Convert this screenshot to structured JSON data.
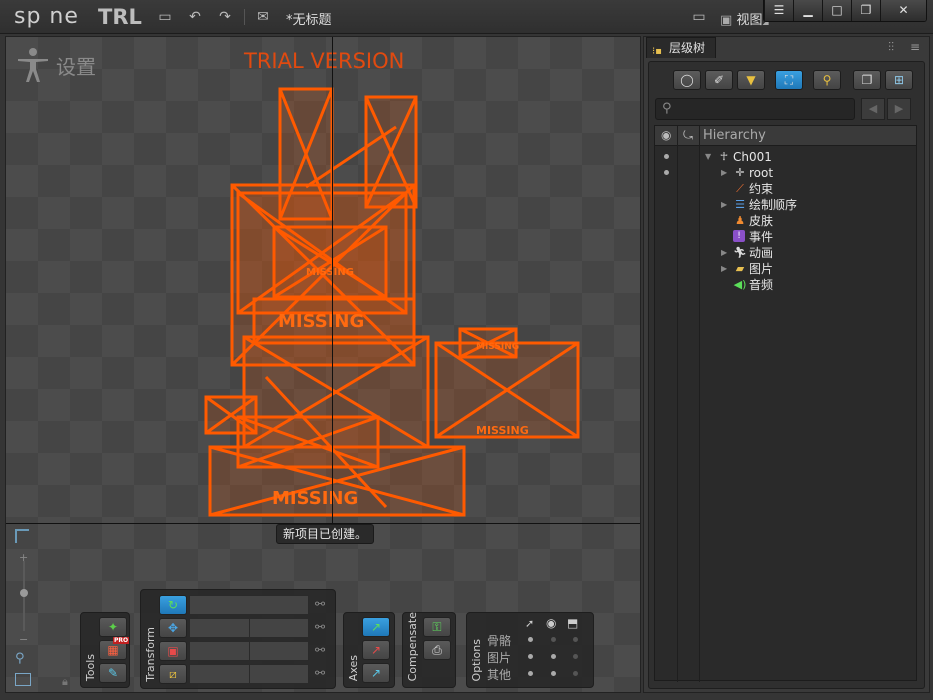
{
  "app": {
    "logo": "sp ne",
    "edition": "TRL",
    "document_title": "*无标题",
    "view_menu_label": "视图"
  },
  "viewport": {
    "title": "设置",
    "watermark": "TRIAL VERSION",
    "status_message": "新项目已创建。",
    "missing_label": "MISSING"
  },
  "toolbar": {
    "tools_label": "Tools",
    "transform_label": "Transform",
    "axes_label": "Axes",
    "compensate_label": "Compensate",
    "options_label": "Options",
    "pro_badge": "PRO",
    "options_rows": [
      "骨骼",
      "图片",
      "其他"
    ]
  },
  "panel": {
    "tab_label": "层级树",
    "tree_header": "Hierarchy",
    "tree": [
      {
        "label": "Ch001",
        "icon": "skeleton-icon",
        "arrow": "▼"
      },
      {
        "label": "root",
        "icon": "bone-icon",
        "arrow": "▶"
      },
      {
        "label": "约束",
        "icon": "constraint-icon",
        "arrow": ""
      },
      {
        "label": "绘制顺序",
        "icon": "draw-order-icon",
        "arrow": "▶"
      },
      {
        "label": "皮肤",
        "icon": "skin-icon",
        "arrow": ""
      },
      {
        "label": "事件",
        "icon": "event-icon",
        "arrow": ""
      },
      {
        "label": "动画",
        "icon": "animation-icon",
        "arrow": "▶"
      },
      {
        "label": "图片",
        "icon": "images-icon",
        "arrow": "▶"
      },
      {
        "label": "音频",
        "icon": "audio-icon",
        "arrow": ""
      }
    ]
  },
  "colors": {
    "accent_orange": "#ff5a00",
    "active_blue": "#2a8fd0",
    "trial_red": "#e04a10"
  }
}
